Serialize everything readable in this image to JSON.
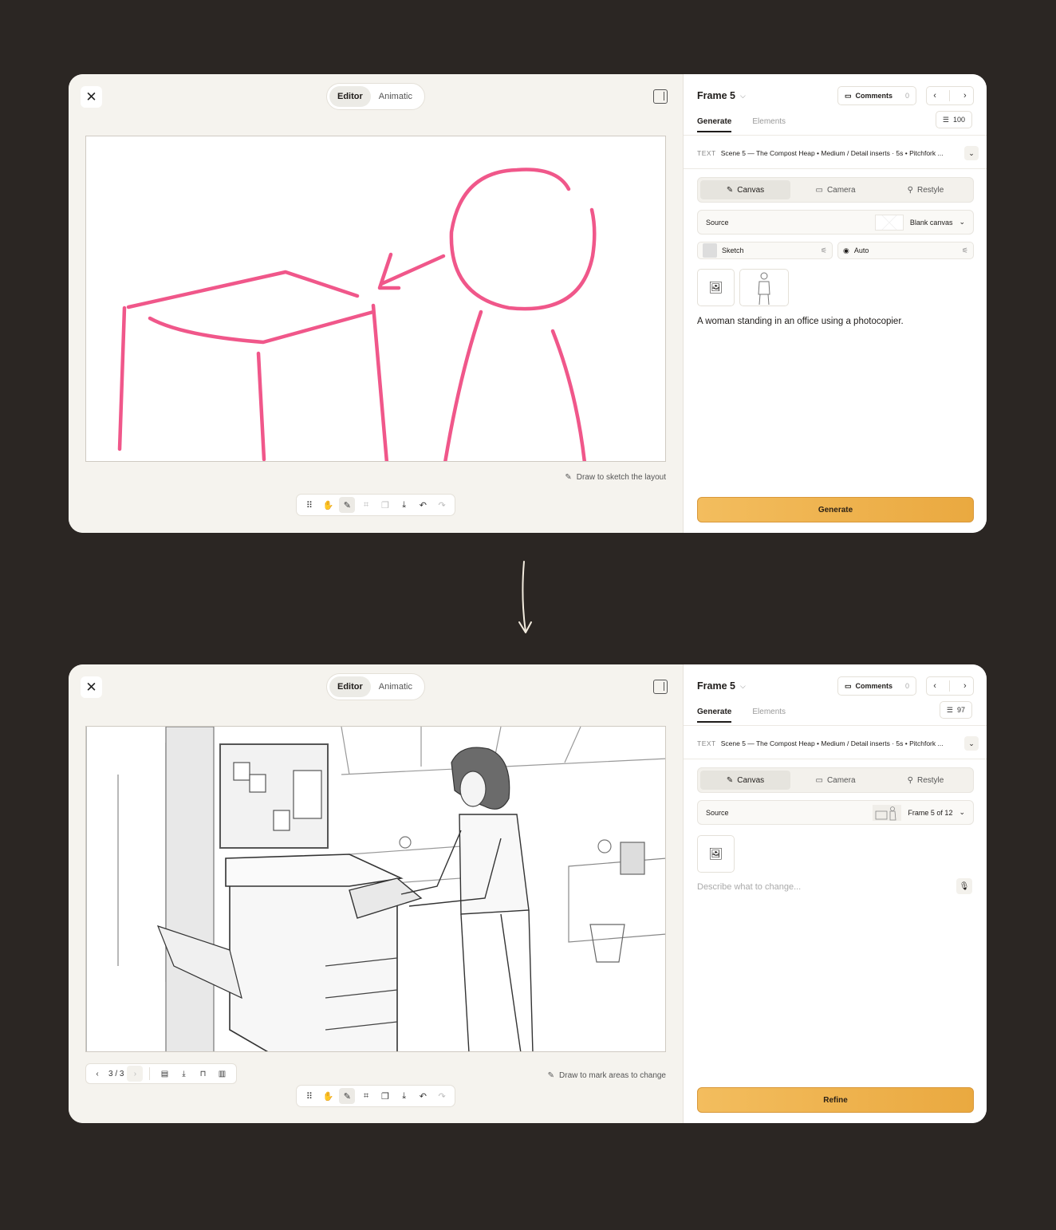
{
  "colors": {
    "background": "#2b2623",
    "window": "#f5f3ee",
    "sketch_stroke": "#f0578a",
    "cta": "#f0b551"
  },
  "before": {
    "mode_tabs": [
      "Editor",
      "Animatic"
    ],
    "hint": "Draw to sketch the layout",
    "panel": {
      "frame_title": "Frame 5",
      "comments_label": "Comments",
      "comments_count": "0",
      "tabs": [
        "Generate",
        "Elements"
      ],
      "credits": "100",
      "text_type": "TEXT",
      "scene_text": "Scene 5 — The Compost Heap • Medium / Detail inserts · 5s • Pitchfork ...",
      "segments": [
        "Canvas",
        "Camera",
        "Restyle"
      ],
      "source_label": "Source",
      "source_value": "Blank canvas",
      "style_label": "Sketch",
      "camera_label": "Auto",
      "prompt": "A woman standing in an office using a photocopier.",
      "cta": "Generate"
    }
  },
  "after": {
    "mode_tabs": [
      "Editor",
      "Animatic"
    ],
    "hint": "Draw to mark areas to change",
    "pager": "3 / 3",
    "panel": {
      "frame_title": "Frame 5",
      "comments_label": "Comments",
      "comments_count": "0",
      "tabs": [
        "Generate",
        "Elements"
      ],
      "credits": "97",
      "text_type": "TEXT",
      "scene_text": "Scene 5 — The Compost Heap • Medium / Detail inserts · 5s • Pitchfork ...",
      "segments": [
        "Canvas",
        "Camera",
        "Restyle"
      ],
      "source_label": "Source",
      "source_value": "Frame 5 of 12",
      "prompt_placeholder": "Describe what to change...",
      "cta": "Refine"
    }
  },
  "icons": {
    "close": "close-icon",
    "panel": "panel-toggle-icon",
    "hint": "pencil-icon",
    "tools": [
      "drag-handle-icon",
      "hand-icon",
      "pencil-icon",
      "crop-icon",
      "layers-icon",
      "download-icon",
      "undo-icon",
      "redo-icon"
    ],
    "pager_tools": [
      "archive-icon",
      "download-icon",
      "unlock-icon",
      "trash-icon"
    ],
    "flow": "down-arrow-icon"
  }
}
